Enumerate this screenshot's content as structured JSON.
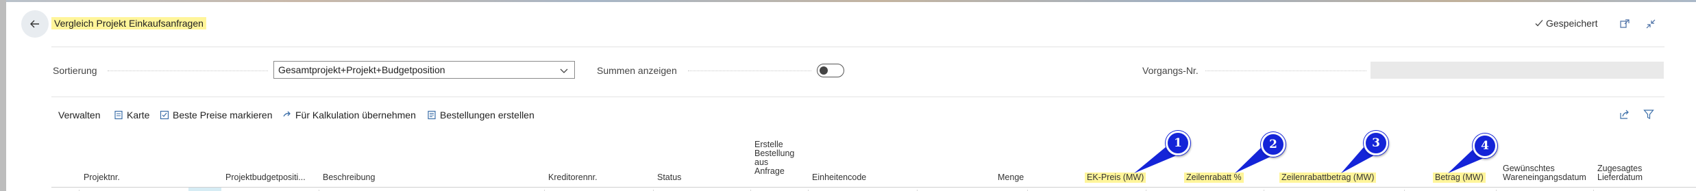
{
  "header": {
    "title": "Vergleich Projekt Einkaufsanfragen",
    "saved_status": "Gespeichert",
    "icons": {
      "back": "arrow-left-icon",
      "saved": "checkmark-icon",
      "open_new": "open-in-new-window-icon",
      "collapse": "collapse-icon"
    }
  },
  "fields": {
    "sortierung_label": "Sortierung",
    "sortierung_value": "Gesamtprojekt+Projekt+Budgetposition",
    "summen_label": "Summen anzeigen",
    "summen_on": false,
    "vorgang_label": "Vorgangs-Nr.",
    "vorgang_value": ""
  },
  "actions": {
    "verwalten": "Verwalten",
    "karte": "Karte",
    "beste_preise": "Beste Preise markieren",
    "kalkulation": "Für Kalkulation übernehmen",
    "bestellungen": "Bestellungen erstellen",
    "icons": {
      "karte": "card-icon",
      "beste_preise": "mark-icon",
      "kalkulation": "arrow-right-icon",
      "bestellungen": "order-icon",
      "share": "share-icon",
      "filter": "filter-icon"
    }
  },
  "columns": {
    "projektnr": "Projektnr.",
    "budgetposition": "Projektbudgetpositi...",
    "beschreibung": "Beschreibung",
    "kreditorennr": "Kreditorennr.",
    "status": "Status",
    "erstelle": [
      "Erstelle",
      "Bestellung",
      "aus",
      "Anfrage"
    ],
    "einheitencode": "Einheitencode",
    "menge": "Menge",
    "ek_preis": "EK-Preis (MW)",
    "zeilenrabatt": "Zeilenrabatt %",
    "zeilenrabattbetrag": "Zeilenrabattbetrag (MW)",
    "betrag": "Betrag (MW)",
    "wareneingang": [
      "Gewünschtes",
      "Wareneingangsdatum"
    ],
    "lieferdatum": [
      "Zugesagtes",
      "Lieferdatum"
    ]
  },
  "annotations": [
    {
      "label": "1"
    },
    {
      "label": "2"
    },
    {
      "label": "3"
    },
    {
      "label": "4"
    }
  ],
  "colors": {
    "highlight": "#fff59a",
    "badge": "#1424d8",
    "panel": "#ffffff"
  }
}
